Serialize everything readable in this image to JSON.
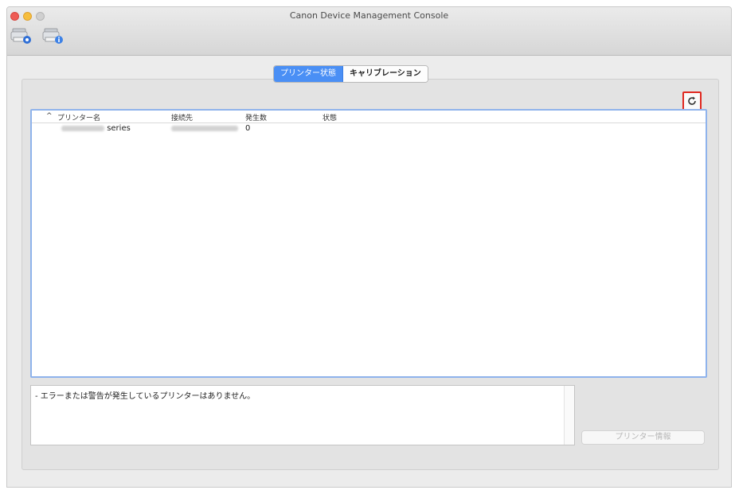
{
  "window": {
    "title": "Canon Device Management Console"
  },
  "toolbar": {
    "buttons": [
      {
        "icon": "printer-settings-icon"
      },
      {
        "icon": "printer-info-icon"
      }
    ]
  },
  "tabs": [
    {
      "label": "プリンター状態",
      "active": true
    },
    {
      "label": "キャリブレーション",
      "active": false
    }
  ],
  "refresh": {
    "icon": "refresh-icon"
  },
  "table": {
    "sort_indicator": "^",
    "columns": [
      "プリンター名",
      "接続先",
      "発生数",
      "状態"
    ],
    "rows": [
      {
        "printer_name_suffix": "series",
        "count": "0",
        "status": ""
      }
    ]
  },
  "message": "- エラーまたは警告が発生しているプリンターはありません。",
  "info_button": {
    "label": "プリンター情報"
  },
  "colors": {
    "accent": "#4a8ff5",
    "highlight": "#e0271f",
    "close": "#ee5c55",
    "minimize": "#f6be3d"
  }
}
